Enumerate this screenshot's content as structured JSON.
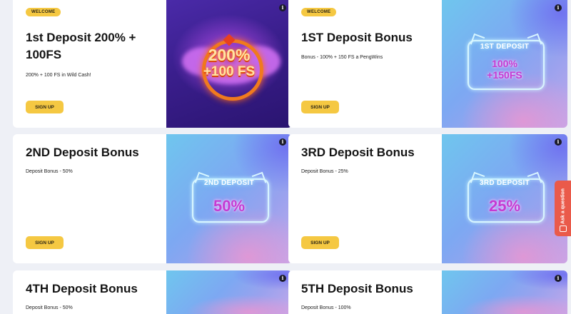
{
  "cards": [
    {
      "badge": "WELCOME",
      "title": "1st Deposit 200% + 100FS",
      "description": "200% + 100 FS in Wild Cash!",
      "button": "SIGN UP",
      "art": {
        "style": "fire",
        "line1": "200%",
        "line2": "+100 FS"
      },
      "info": "i"
    },
    {
      "badge": "WELCOME",
      "title": "1ST Deposit Bonus",
      "description": "Bonus - 100% + 150 FS a PengWins",
      "button": "SIGN UP",
      "art": {
        "style": "neon",
        "line1": "1ST DEPOSIT",
        "line2": "100%",
        "line3": "+150FS"
      },
      "info": "i"
    },
    {
      "title": "2ND Deposit Bonus",
      "description": "Deposit Bonus - 50%",
      "button": "SIGN UP",
      "art": {
        "style": "neon",
        "line1": "2ND DEPOSIT",
        "line2": "50%"
      },
      "info": "i"
    },
    {
      "title": "3RD Deposit Bonus",
      "description": "Deposit Bonus - 25%",
      "button": "SIGN UP",
      "art": {
        "style": "neon",
        "line1": "3RD DEPOSIT",
        "line2": "25%"
      },
      "info": "i"
    },
    {
      "title": "4TH Deposit Bonus",
      "description": "Deposit Bonus - 50%",
      "info": "i"
    },
    {
      "title": "5TH Deposit Bonus",
      "description": "Deposit Bonus - 100%",
      "info": "i"
    }
  ],
  "ask_widget": {
    "label": "Ask a question",
    "icon": "chat-bubble-icon"
  },
  "colors": {
    "page_bg": "#eef0f6",
    "button_yellow": "#f5c842",
    "neon_pink": "#c53ad2",
    "ask_red": "#ea5a4a"
  }
}
